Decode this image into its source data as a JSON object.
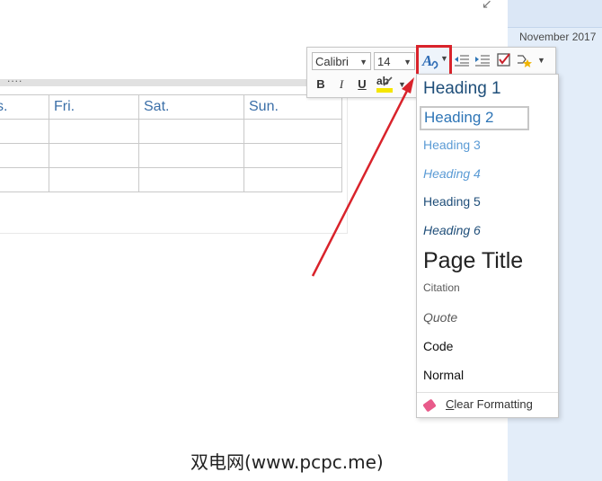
{
  "date_panel": {
    "label": "November 2017"
  },
  "table": {
    "handle_dots": "....",
    "header": [
      "s.",
      "Fri.",
      "Sat.",
      "Sun."
    ],
    "rows": 4
  },
  "toolbar": {
    "font_name": "Calibri",
    "font_size": "14",
    "bold_label": "B",
    "italic_label": "I",
    "underline_label": "U",
    "highlight_label": "ab"
  },
  "styles_menu": {
    "items": [
      "Heading 1",
      "Heading 2",
      "Heading 3",
      "Heading 4",
      "Heading 5",
      "Heading 6",
      "Page Title",
      "Citation",
      "Quote",
      "Code",
      "Normal"
    ],
    "clear_formatting": {
      "accel": "C",
      "rest": "lear Formatting"
    }
  },
  "watermark": "双电网(www.pcpc.me)",
  "colors": {
    "highlight_red": "#d9232b",
    "heading_dark": "#1e4e79",
    "heading_mid": "#2e75b6",
    "heading_light": "#5b9bd5",
    "panel_blue": "#e3edf9"
  },
  "icons": {
    "styles": "text-styles-icon",
    "indent_decrease": "indent-decrease-icon",
    "indent_increase": "indent-increase-icon",
    "todo": "checkbox-tag-icon",
    "tag": "tag-star-icon",
    "eraser": "eraser-icon",
    "highlighter": "highlighter-icon"
  }
}
